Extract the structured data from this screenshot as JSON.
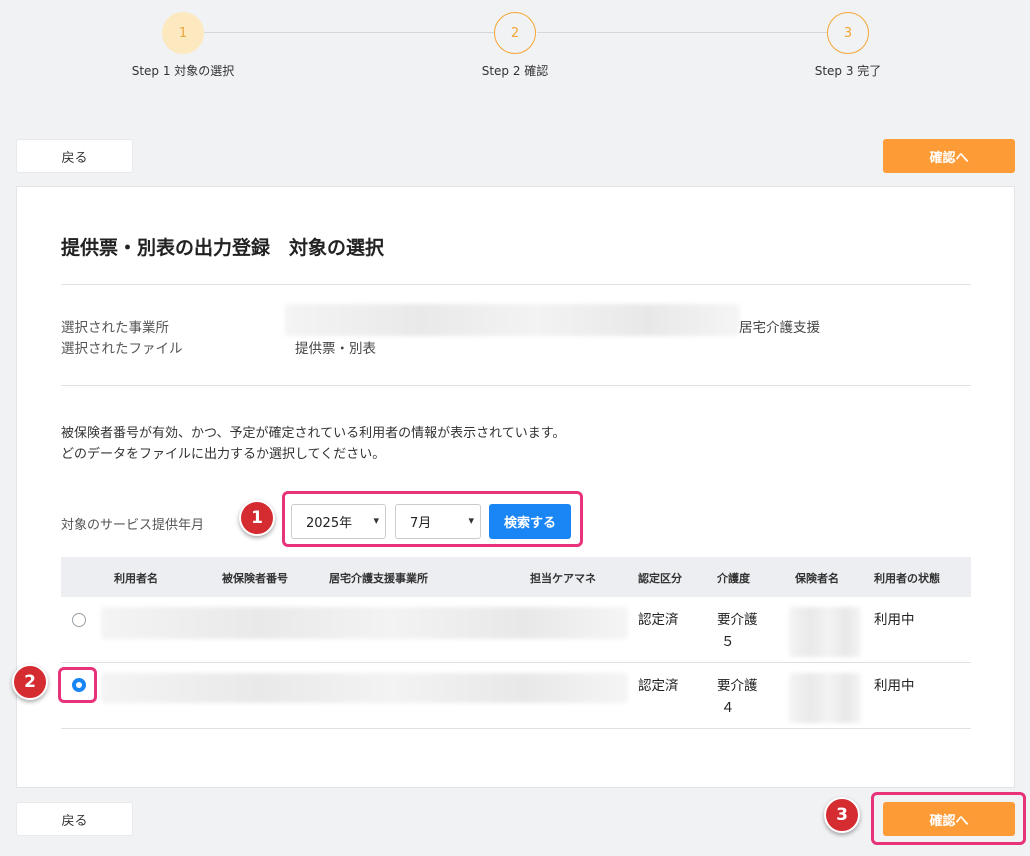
{
  "stepper": {
    "steps": [
      {
        "number": "1",
        "label": "Step 1 対象の選択"
      },
      {
        "number": "2",
        "label": "Step 2 確認"
      },
      {
        "number": "3",
        "label": "Step 3 完了"
      }
    ]
  },
  "nav": {
    "back_label": "戻る",
    "next_label": "確認へ"
  },
  "page": {
    "title": "提供票・別表の出力登録　対象の選択",
    "office_label": "選択された事業所",
    "office_suffix": "居宅介護支援",
    "file_label": "選択されたファイル",
    "file_value": "提供票・別表",
    "description_line1": "被保険者番号が有効、かつ、予定が確定されている利用者の情報が表示されています。",
    "description_line2": "どのデータをファイルに出力するか選択してください。"
  },
  "filter": {
    "label": "対象のサービス提供年月",
    "year": "2025年",
    "month": "7月",
    "search_label": "検索する"
  },
  "table": {
    "headers": [
      "利用者名",
      "被保険者番号",
      "居宅介護支援事業所",
      "担当ケアマネ",
      "認定区分",
      "介護度",
      "保険者名",
      "利用者の状態"
    ],
    "rows": [
      {
        "cert": "認定済",
        "care_level_1": "要介護",
        "care_level_2": "５",
        "status": "利用中",
        "selected": false
      },
      {
        "cert": "認定済",
        "care_level_1": "要介護",
        "care_level_2": "４",
        "status": "利用中",
        "selected": true
      }
    ]
  },
  "annotations": [
    "1",
    "2",
    "3"
  ],
  "colors": {
    "accent_orange": "#fd9b36",
    "primary_blue": "#1a85f5",
    "highlight_pink": "#e8337a",
    "badge_red": "#d42c31"
  }
}
